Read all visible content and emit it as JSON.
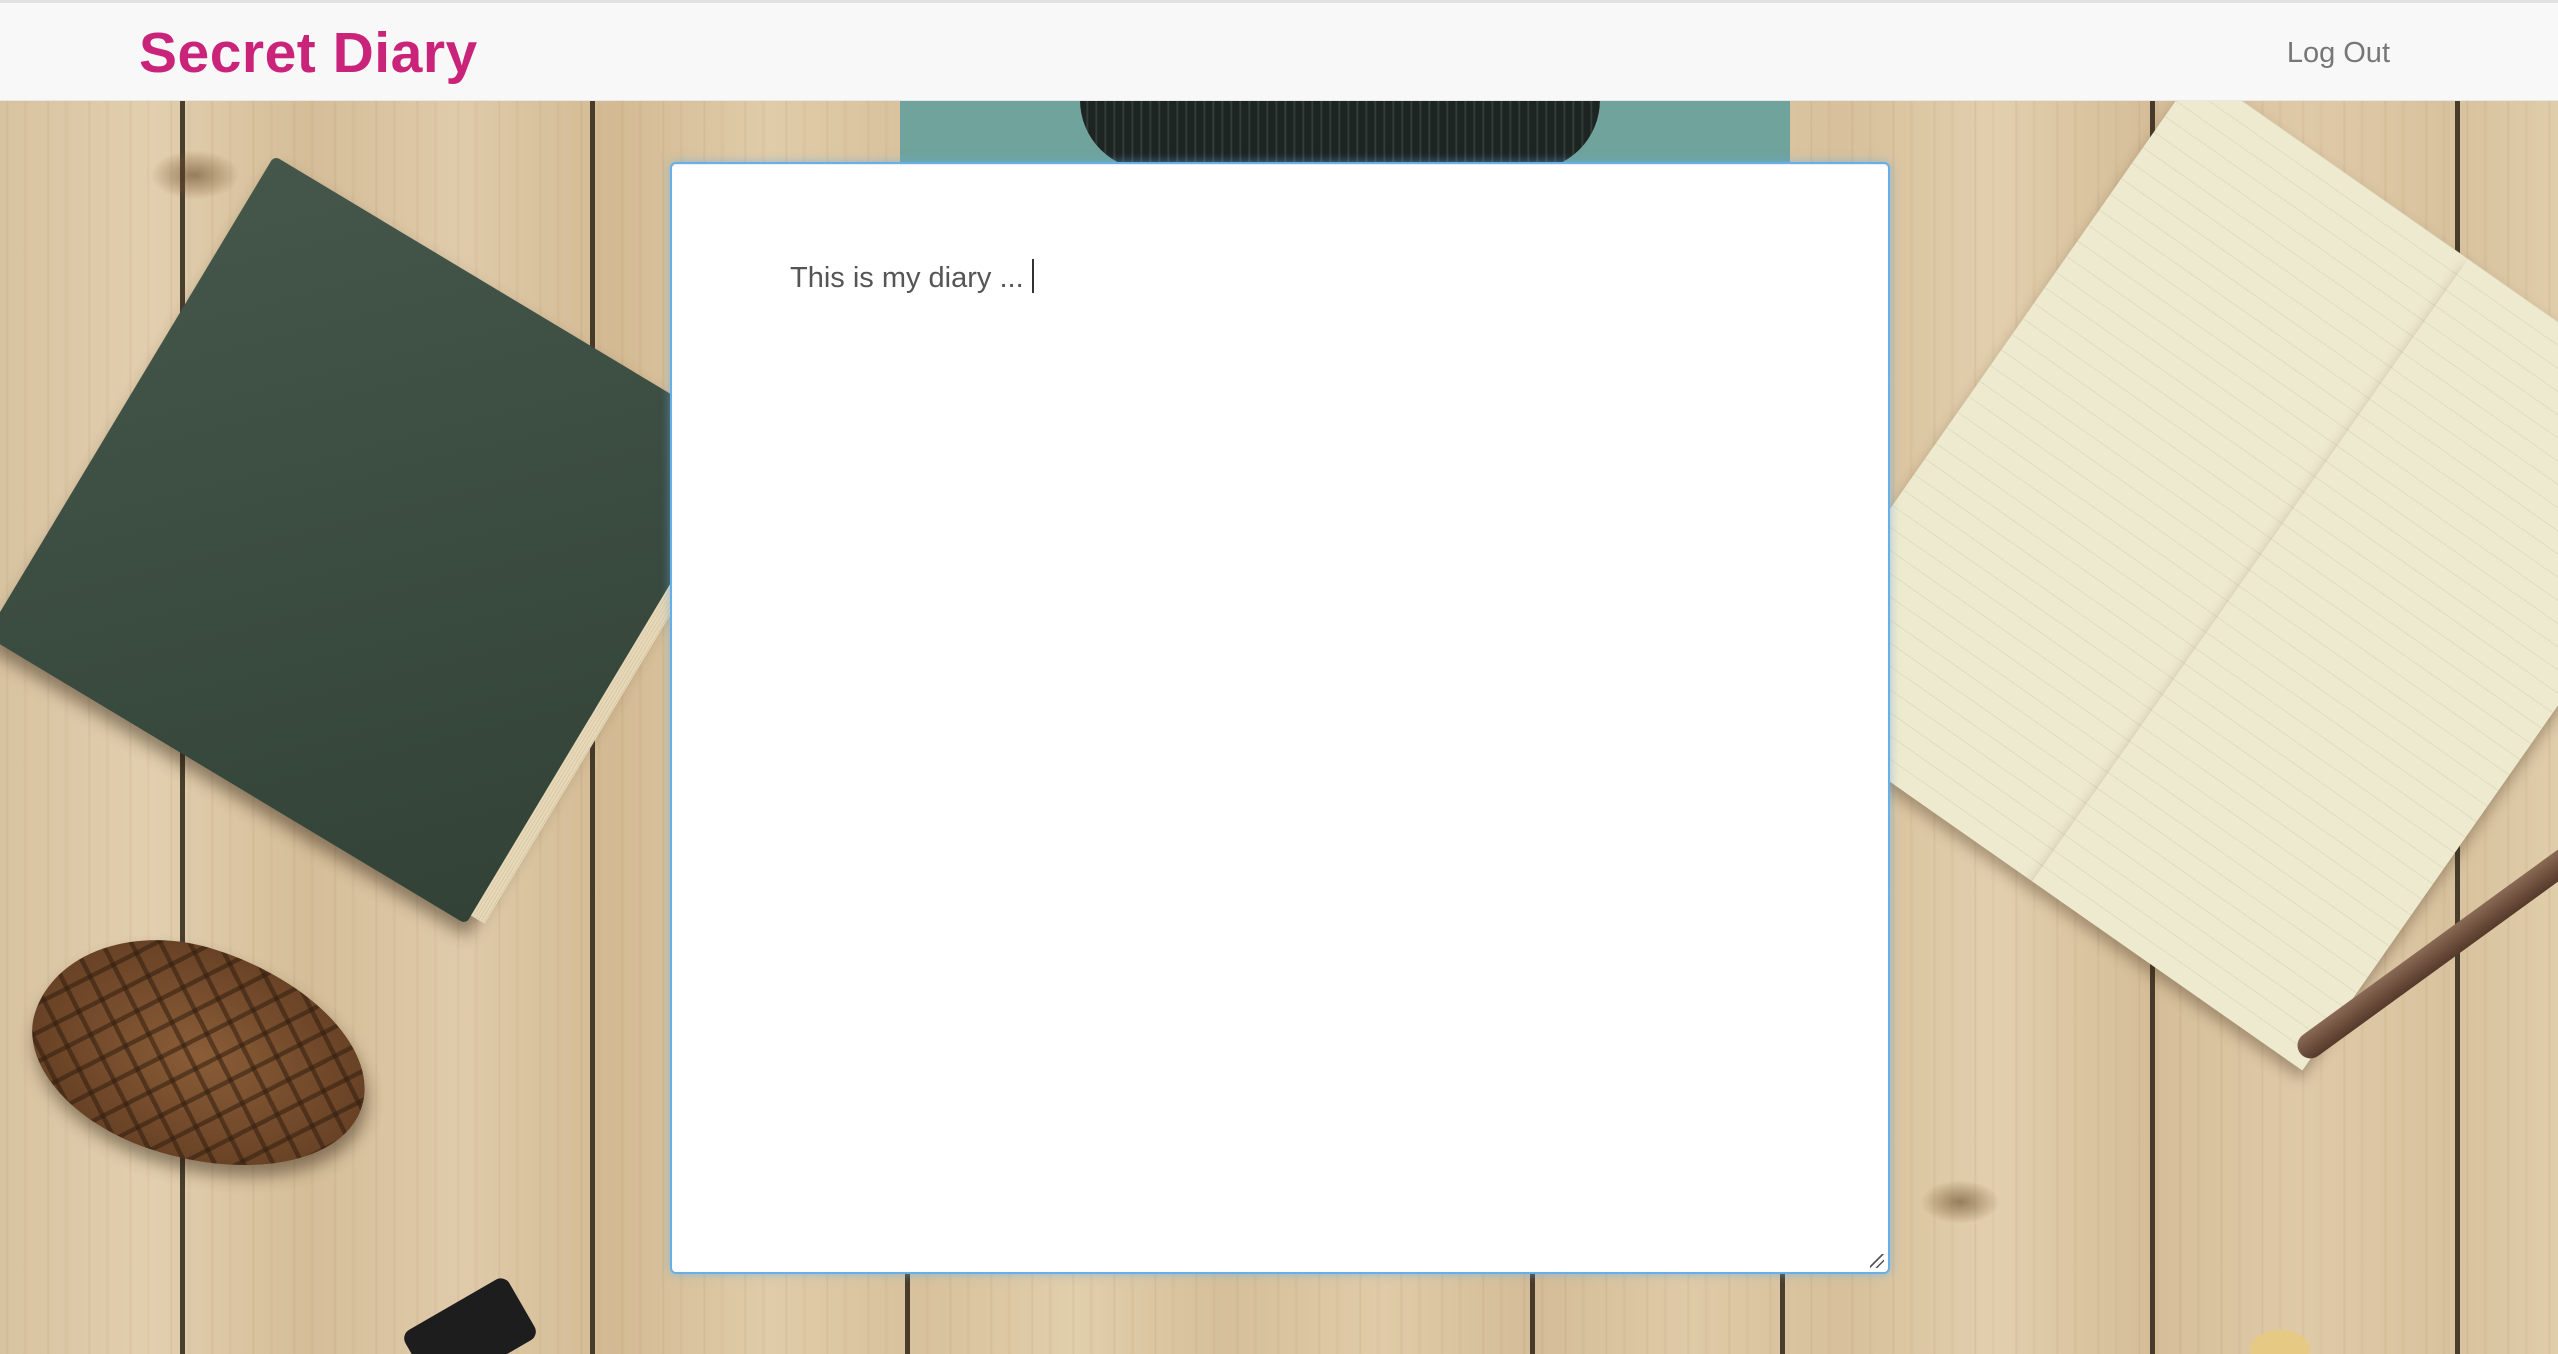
{
  "navbar": {
    "brand": "Secret Diary",
    "logout_label": "Log Out"
  },
  "diary": {
    "content": "This is my diary ..."
  },
  "colors": {
    "brand": "#c9247a",
    "navbar_bg": "#f8f8f8",
    "focus_border": "#66afe9",
    "link": "#777777"
  }
}
